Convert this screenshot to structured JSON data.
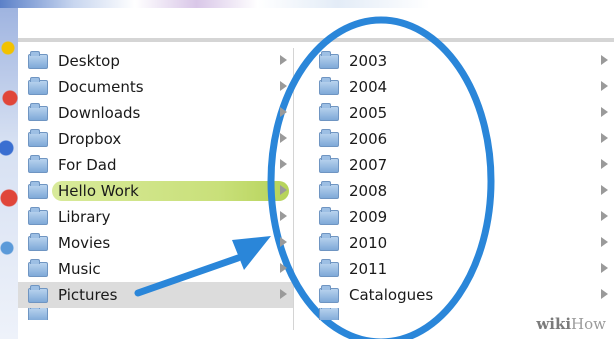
{
  "finder": {
    "left_column": [
      {
        "label": "Desktop",
        "icon": "folder-icon",
        "has_arrow": true
      },
      {
        "label": "Documents",
        "icon": "folder-icon",
        "has_arrow": true
      },
      {
        "label": "Downloads",
        "icon": "folder-icon",
        "has_arrow": true
      },
      {
        "label": "Dropbox",
        "icon": "folder-icon",
        "has_arrow": true
      },
      {
        "label": "For Dad",
        "icon": "folder-icon",
        "has_arrow": true
      },
      {
        "label": "Hello Work",
        "icon": "folder-icon",
        "has_arrow": true,
        "tag_color": "#c9e07a"
      },
      {
        "label": "Library",
        "icon": "folder-icon",
        "has_arrow": true
      },
      {
        "label": "Movies",
        "icon": "folder-icon",
        "has_arrow": true
      },
      {
        "label": "Music",
        "icon": "folder-icon",
        "has_arrow": true
      },
      {
        "label": "Pictures",
        "icon": "folder-icon",
        "has_arrow": true,
        "selected": true
      }
    ],
    "right_column": [
      {
        "label": "2003",
        "icon": "folder-icon",
        "has_arrow": true
      },
      {
        "label": "2004",
        "icon": "folder-icon",
        "has_arrow": true
      },
      {
        "label": "2005",
        "icon": "folder-icon",
        "has_arrow": true
      },
      {
        "label": "2006",
        "icon": "folder-icon",
        "has_arrow": true
      },
      {
        "label": "2007",
        "icon": "folder-icon",
        "has_arrow": true
      },
      {
        "label": "2008",
        "icon": "folder-icon",
        "has_arrow": true
      },
      {
        "label": "2009",
        "icon": "folder-icon",
        "has_arrow": true
      },
      {
        "label": "2010",
        "icon": "folder-icon",
        "has_arrow": true
      },
      {
        "label": "2011",
        "icon": "folder-icon",
        "has_arrow": true
      },
      {
        "label": "Catalogues",
        "icon": "folder-icon",
        "has_arrow": true
      }
    ]
  },
  "annotation": {
    "color": "#2a86d9",
    "shapes": [
      "circle-highlight",
      "arrow-pointer"
    ]
  },
  "watermark": {
    "wiki": "wiki",
    "how": "How"
  },
  "colors": {
    "selection": "#dcdcdc",
    "tag_green": "#c9e07a",
    "folder_blue": "#7fa9d8"
  }
}
